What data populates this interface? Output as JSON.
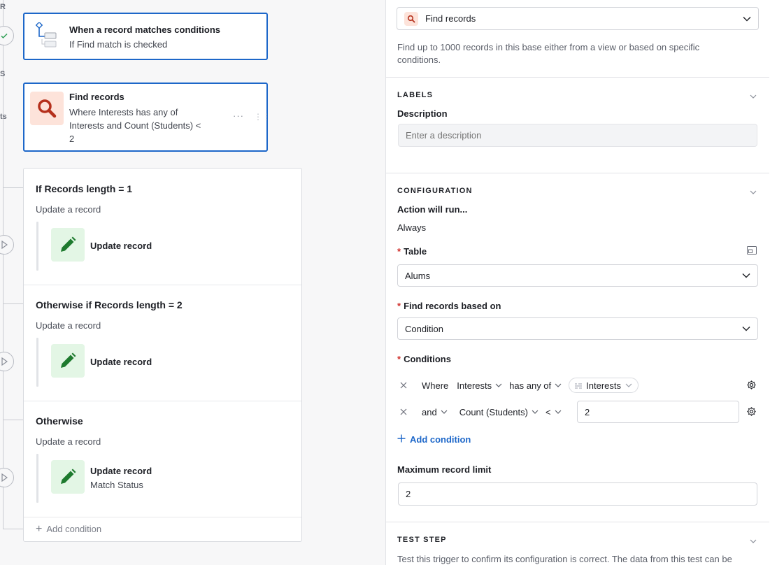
{
  "canvas": {
    "side_labels": [
      "R",
      "S",
      "ts"
    ],
    "trigger_card": {
      "title": "When a record matches conditions",
      "subtitle": "If Find match is checked",
      "icon": "conditional-tree-icon"
    },
    "find_card": {
      "title": "Find records",
      "subtitle_lines": [
        "Where Interests has any of",
        "Interests and Count (Students) <",
        "2"
      ],
      "icon": "search-icon",
      "more": "···",
      "grip": "⋮⋮"
    },
    "branches": [
      {
        "title": "If Records length = 1",
        "sub": "Update a record",
        "action_title": "Update record",
        "action_sub": ""
      },
      {
        "title": "Otherwise if Records length = 2",
        "sub": "Update a record",
        "action_title": "Update record",
        "action_sub": ""
      },
      {
        "title": "Otherwise",
        "sub": "Update a record",
        "action_title": "Update record",
        "action_sub": "Match Status"
      }
    ],
    "add_condition": "Add condition"
  },
  "panel": {
    "action_select": {
      "value": "Find records",
      "icon": "search-icon"
    },
    "action_help": "Find up to 1000 records in this base either from a view or based on specific conditions.",
    "labels_section": {
      "heading": "LABELS",
      "description_label": "Description",
      "description_placeholder": "Enter a description"
    },
    "config_section": {
      "heading": "CONFIGURATION",
      "action_will_run_label": "Action will run...",
      "action_will_run_value": "Always",
      "table_label": "Table",
      "table_value": "Alums",
      "find_based_on_label": "Find records based on",
      "find_based_on_value": "Condition",
      "conditions_label": "Conditions",
      "conditions": [
        {
          "conj": "Where",
          "field": "Interests",
          "op": "has any of",
          "value": "Interests"
        },
        {
          "conj": "and",
          "field": "Count (Students)",
          "op": "<",
          "value": "2"
        }
      ],
      "add_condition": "Add condition",
      "max_limit_label": "Maximum record limit",
      "max_limit_value": "2"
    },
    "test_section": {
      "heading": "TEST STEP",
      "text": "Test this trigger to confirm its configuration is correct. The data from this test can be"
    }
  },
  "colors": {
    "accent_blue": "#1d67c9",
    "find_icon_bg": "#fde3da",
    "find_icon_fg": "#b5301c",
    "update_icon_bg": "#e3f6e5",
    "update_icon_fg": "#1e7a2e",
    "required": "#d0312d"
  }
}
